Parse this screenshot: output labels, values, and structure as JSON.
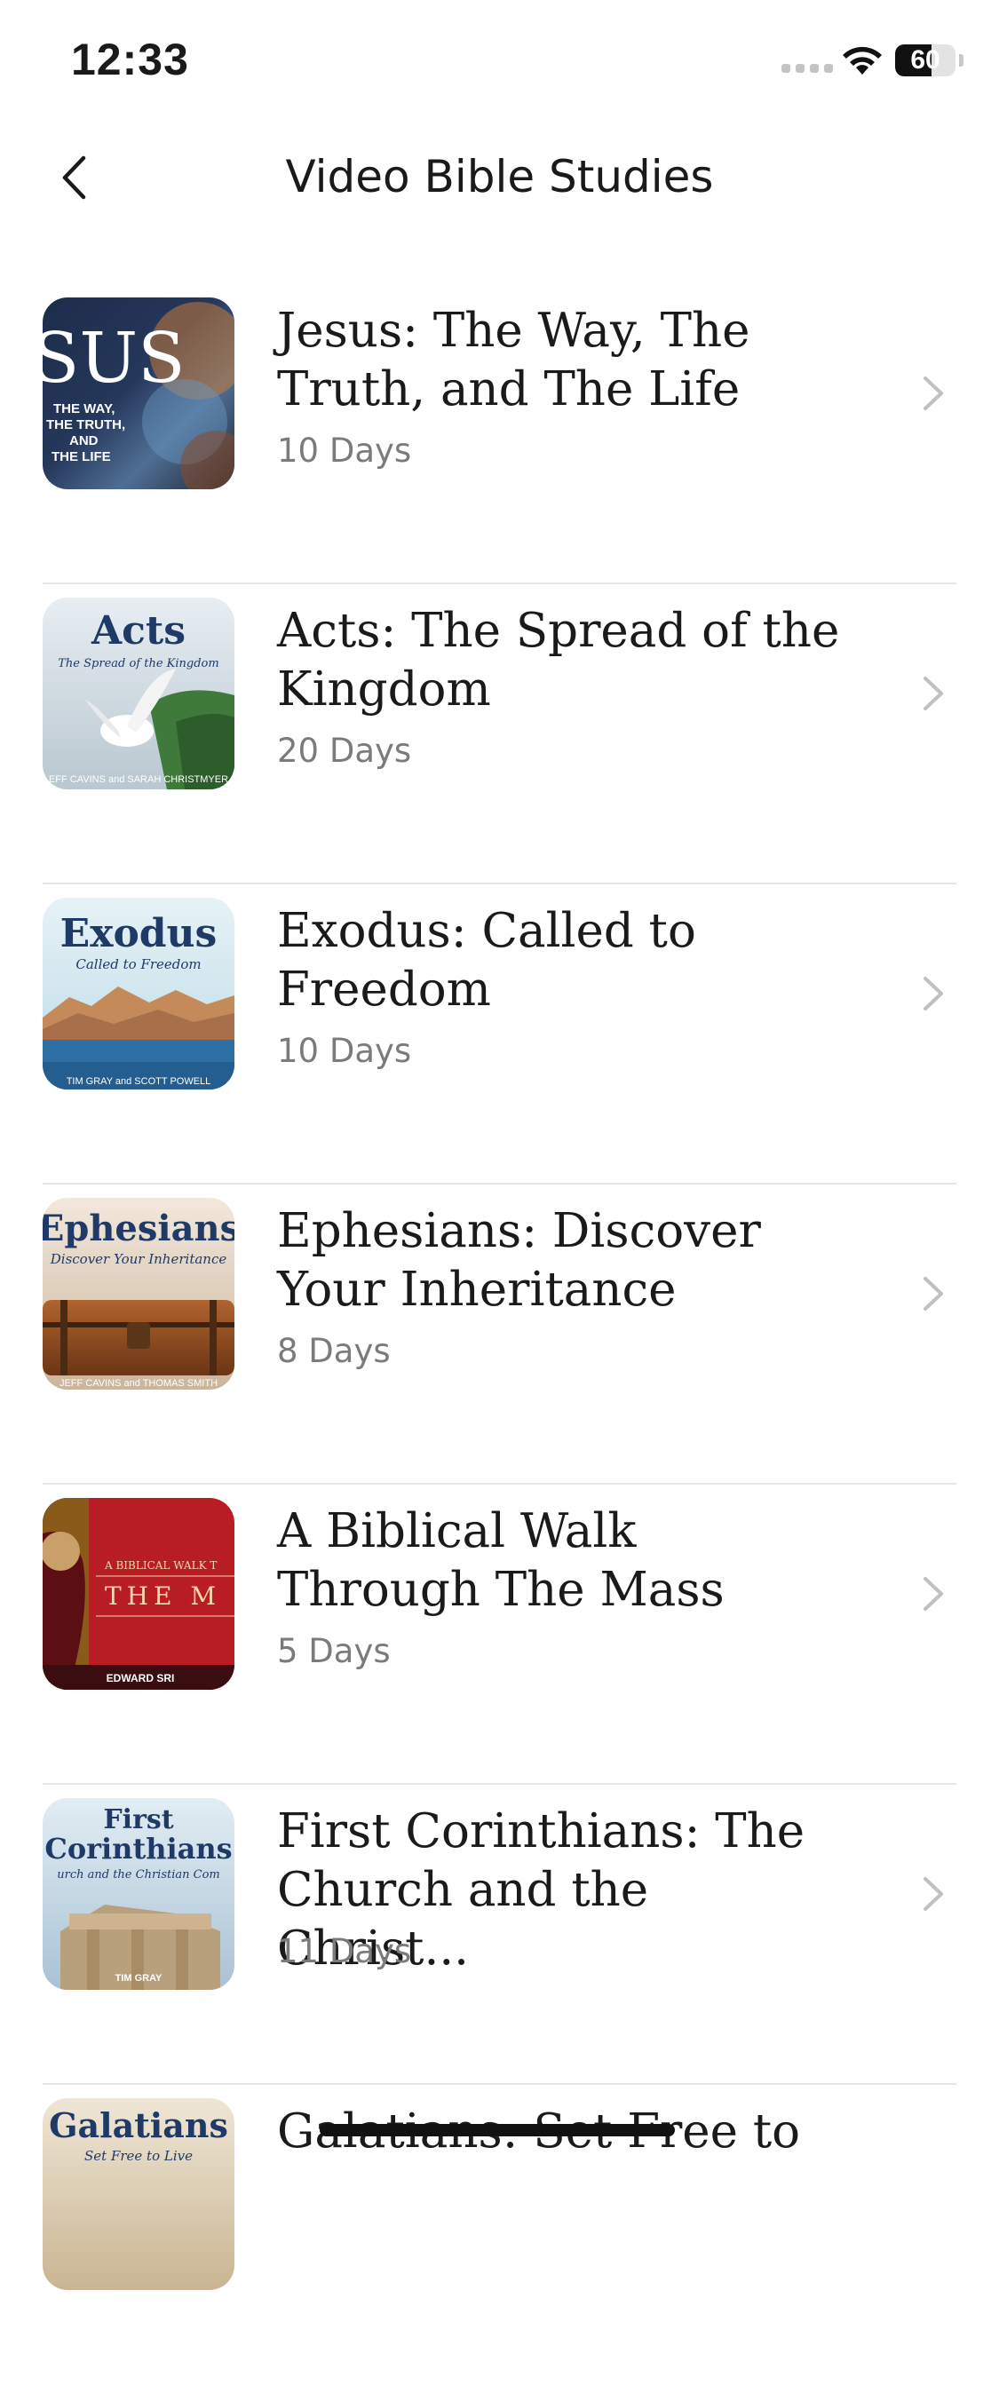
{
  "status_bar": {
    "time": "12:33",
    "battery": "60",
    "battery_level": 0.6
  },
  "nav": {
    "title": "Video Bible Studies"
  },
  "studies": [
    {
      "title": "Jesus: The Way, The\nTruth, and The Life",
      "duration": "10 Days",
      "cover": {
        "big": "SUS",
        "sub": [
          "THE WAY,",
          "THE TRUTH,",
          "AND",
          "THE LIFE"
        ]
      }
    },
    {
      "title": "Acts: The Spread of the\nKingdom",
      "duration": "20 Days",
      "cover": {
        "big": "Acts",
        "sub": "The Spread of the Kingdom",
        "credit": "EFF CAVINS and SARAH CHRISTMYER"
      }
    },
    {
      "title": "Exodus: Called to\nFreedom",
      "duration": "10 Days",
      "cover": {
        "big": "Exodus",
        "sub": "Called to Freedom",
        "credit": "TIM GRAY and SCOTT POWELL"
      }
    },
    {
      "title": "Ephesians: Discover\nYour Inheritance",
      "duration": "8 Days",
      "cover": {
        "big": "Ephesians",
        "sub": "Discover Your Inheritance",
        "credit": "JEFF CAVINS and THOMAS SMITH"
      }
    },
    {
      "title": "A Biblical Walk\nThrough The Mass",
      "duration": "5 Days",
      "cover": {
        "small": "A BIBLICAL WALK T",
        "big": "THE M",
        "credit": "EDWARD SRI"
      }
    },
    {
      "title": "First  Corinthians: The\nChurch and the Christ...",
      "duration": "11 Days",
      "cover": {
        "big": [
          "First",
          "Corinthians"
        ],
        "sub": "urch and the Christian Com",
        "credit": "TIM GRAY"
      }
    },
    {
      "title": "Galatians: Set Free to",
      "duration": "",
      "cover": {
        "big": "Galatians",
        "sub": "Set Free to Live"
      }
    }
  ],
  "icons": {
    "back": "chevron-left-icon",
    "row_arrow": "chevron-right-icon",
    "wifi": "wifi-icon",
    "signal": "cellular-signal-icon",
    "battery": "battery-icon"
  },
  "colors": {
    "text": "#1a1a1a",
    "secondary_text": "#7b7b7b",
    "divider": "#e5e5e5",
    "chevron": "#c0c0c0"
  }
}
